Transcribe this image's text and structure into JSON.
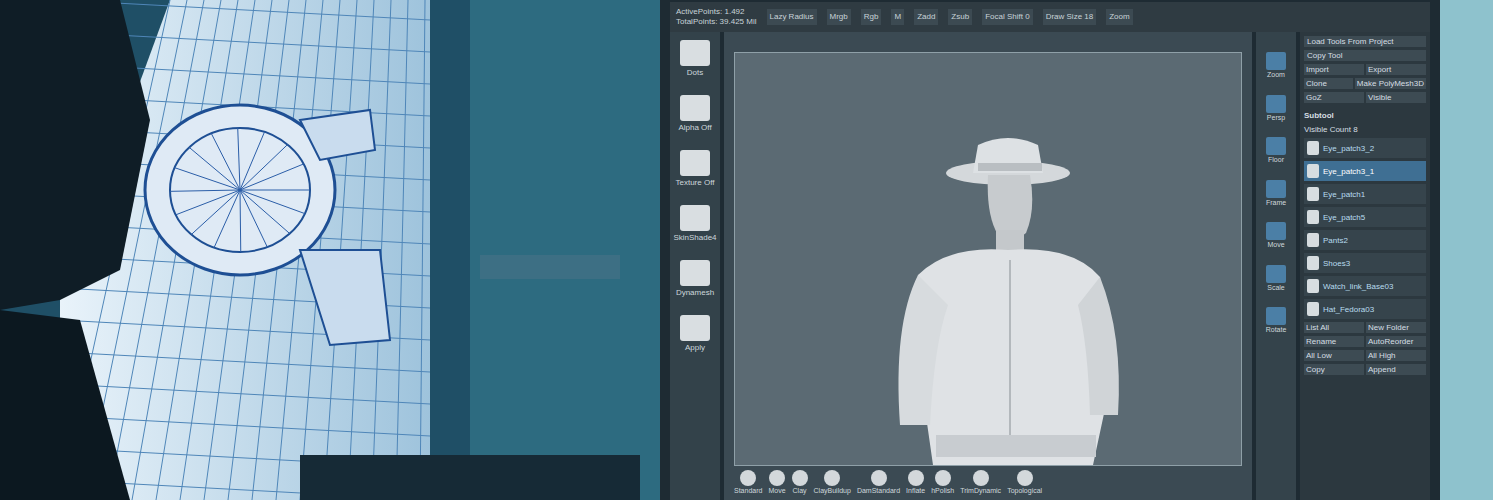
{
  "zbrush": {
    "top_bar": {
      "active_points": "ActivePoints: 1.492",
      "total_points": "TotalPoints: 39.425 Mil",
      "items": [
        "Lazy Radius",
        "Mrgb",
        "Rgb",
        "M",
        "Zadd",
        "Zsub",
        "Focal Shift 0",
        "Draw Size 18",
        "Zoom"
      ]
    },
    "left_shelf": [
      "Dots",
      "Alpha Off",
      "Texture Off",
      "SkinShade4",
      "Dynamesh",
      "Apply"
    ],
    "right_icons": [
      "Zoom",
      "Persp",
      "Floor",
      "Frame",
      "Move",
      "Scale",
      "Rotate"
    ],
    "tool_panel": {
      "top": [
        "Load Tools From Project",
        "Copy Tool"
      ],
      "pairs": [
        [
          "Import",
          "Export"
        ],
        [
          "Clone",
          "Make PolyMesh3D"
        ],
        [
          "GoZ",
          "Visible"
        ]
      ]
    },
    "subtool": {
      "title": "Subtool",
      "count": "Visible Count 8",
      "items": [
        {
          "label": "Eye_patch3_2",
          "selected": false
        },
        {
          "label": "Eye_patch3_1",
          "selected": true
        },
        {
          "label": "Eye_patch1",
          "selected": false
        },
        {
          "label": "Eye_patch5",
          "selected": false
        },
        {
          "label": "Pants2",
          "selected": false
        },
        {
          "label": "Shoes3",
          "selected": false
        },
        {
          "label": "Watch_link_Base03",
          "selected": false
        },
        {
          "label": "Hat_Fedora03",
          "selected": false
        }
      ],
      "buttons": [
        [
          "List All",
          "New Folder"
        ],
        [
          "Rename",
          "AutoReorder"
        ],
        [
          "All Low",
          "All High"
        ],
        [
          "Copy",
          "Append"
        ]
      ]
    },
    "brushes": [
      "Standard",
      "Move",
      "Clay",
      "ClayBuildup",
      "DamStandard",
      "Inflate",
      "hPolish",
      "TrimDynamic",
      "Topological"
    ]
  }
}
